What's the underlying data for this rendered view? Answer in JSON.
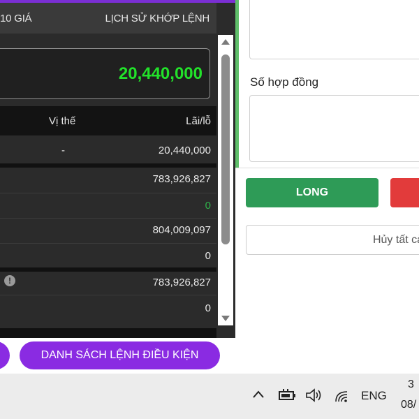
{
  "tabs": {
    "left_label": "10 GIÁ",
    "right_label": "LỊCH SỬ KHỚP LỆNH"
  },
  "balance": "20,440,000",
  "table": {
    "header_position": "Vị thế",
    "header_pnl": "Lãi/lỗ",
    "rows": [
      {
        "position": "-",
        "value": "20,440,000"
      },
      {
        "position": "",
        "value": "783,926,827"
      },
      {
        "position": "",
        "value": "0"
      },
      {
        "position": "",
        "value": "804,009,097"
      },
      {
        "position": "",
        "value": "0"
      },
      {
        "position": "",
        "value": "783,926,827"
      },
      {
        "position": "",
        "value": "0"
      }
    ]
  },
  "bottom_button": "DANH SÁCH LỆNH ĐIỀU KIỆN",
  "form": {
    "contracts_label": "Số hợp đồng",
    "long_label": "LONG",
    "cancel_all_label": "Hủy tất cả"
  },
  "taskbar": {
    "language": "ENG",
    "time_partial": "3",
    "date_partial": "08/"
  },
  "colors": {
    "accent_purple": "#8a2be2",
    "balance_green": "#22e22a",
    "long_green": "#2e9b57",
    "short_red": "#e23b3b"
  },
  "icons": [
    "info-icon",
    "chevron-up-icon",
    "battery-icon",
    "volume-icon",
    "wifi-icon",
    "scroll-up-icon",
    "scroll-down-icon"
  ]
}
